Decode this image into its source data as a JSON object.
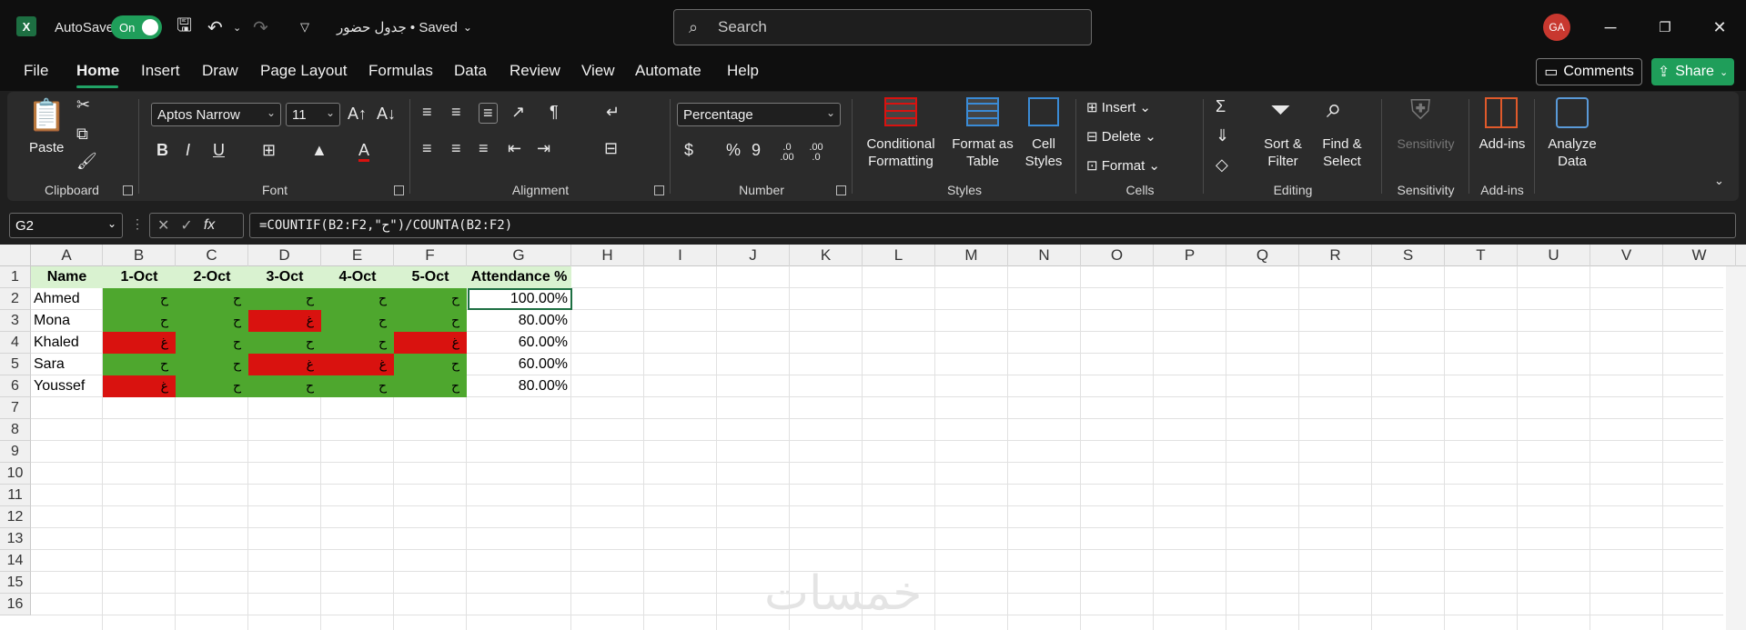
{
  "titlebar": {
    "app_icon": "X",
    "autosave_label": "AutoSave",
    "autosave_state": "On",
    "doc_title": "جدول حضور • Saved",
    "search_placeholder": "Search",
    "avatar_initials": "GA"
  },
  "menu": {
    "items": [
      "File",
      "Home",
      "Insert",
      "Draw",
      "Page Layout",
      "Formulas",
      "Data",
      "Review",
      "View",
      "Automate",
      "Help"
    ],
    "active": "Home",
    "comments_label": "Comments",
    "share_label": "Share"
  },
  "ribbon": {
    "clipboard": {
      "group": "Clipboard",
      "paste": "Paste"
    },
    "font": {
      "group": "Font",
      "family": "Aptos Narrow",
      "size": "11",
      "bold": "B",
      "italic": "I",
      "underline": "U"
    },
    "alignment": {
      "group": "Alignment"
    },
    "number": {
      "group": "Number",
      "format": "Percentage",
      "currency": "$",
      "percent": "%",
      "comma": "9",
      "inc_decimal": ".0 .00",
      "dec_decimal": ".00 .0"
    },
    "styles": {
      "group": "Styles",
      "conditional": [
        "Conditional",
        "Formatting"
      ],
      "format_table": [
        "Format as",
        "Table"
      ],
      "cell_styles": [
        "Cell",
        "Styles"
      ]
    },
    "cells": {
      "group": "Cells",
      "insert": "Insert",
      "delete": "Delete",
      "format": "Format"
    },
    "editing": {
      "group": "Editing",
      "sort": [
        "Sort &",
        "Filter"
      ],
      "find": [
        "Find &",
        "Select"
      ]
    },
    "sensitivity": {
      "group": "Sensitivity",
      "label": "Sensitivity"
    },
    "addins": {
      "group": "Add-ins",
      "label": "Add-ins"
    },
    "analyze": {
      "label": [
        "Analyze",
        "Data"
      ]
    }
  },
  "formula_bar": {
    "name_box": "G2",
    "fx": "fx",
    "formula": "=COUNTIF(B2:F2,\"ح\")/COUNTA(B2:F2)"
  },
  "sheet": {
    "columns": [
      "A",
      "B",
      "C",
      "D",
      "E",
      "F",
      "G",
      "H",
      "I",
      "J",
      "K",
      "L",
      "M",
      "N",
      "O",
      "P",
      "Q",
      "R",
      "S",
      "T",
      "U",
      "V",
      "W"
    ],
    "rows": [
      "1",
      "2",
      "3",
      "4",
      "5",
      "6",
      "7",
      "8",
      "9",
      "10",
      "11",
      "12",
      "13",
      "14",
      "15",
      "16"
    ],
    "header": [
      "Name",
      "1-Oct",
      "2-Oct",
      "3-Oct",
      "4-Oct",
      "5-Oct",
      "Attendance %"
    ],
    "records": [
      {
        "name": "Ahmed",
        "marks": [
          "ح",
          "ح",
          "ح",
          "ح",
          "ح"
        ],
        "pct": "100.00%"
      },
      {
        "name": "Mona",
        "marks": [
          "ح",
          "ح",
          "غ",
          "ح",
          "ح"
        ],
        "pct": "80.00%"
      },
      {
        "name": "Khaled",
        "marks": [
          "غ",
          "ح",
          "ح",
          "ح",
          "غ"
        ],
        "pct": "60.00%"
      },
      {
        "name": "Sara",
        "marks": [
          "ح",
          "ح",
          "غ",
          "غ",
          "ح"
        ],
        "pct": "60.00%"
      },
      {
        "name": "Youssef",
        "marks": [
          "غ",
          "ح",
          "ح",
          "ح",
          "ح"
        ],
        "pct": "80.00%"
      }
    ],
    "present_mark": "ح",
    "present_color": "#4ea72e",
    "absent_color": "#d9120f",
    "header_fill": "#d9f2d0"
  },
  "watermark": "خمسات"
}
